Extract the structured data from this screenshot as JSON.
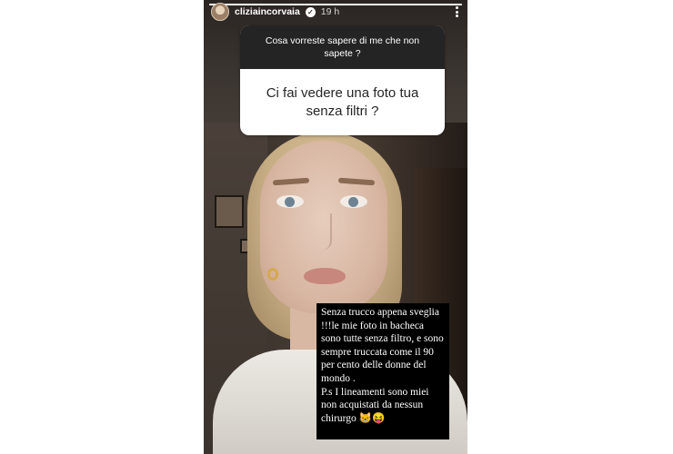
{
  "header": {
    "username": "cliziaincorvaia",
    "verified_icon": "verified-badge-icon",
    "time": "19 h",
    "more_icon": "more-vertical-icon",
    "progress": 1.0
  },
  "question_box": {
    "question": "Cosa vorreste sapere di me che non sapete ?",
    "answer": "Ci fai vedere una foto tua senza filtri ?"
  },
  "caption": {
    "text": "Senza trucco appena sveglia !!!le mie foto in bacheca sono tutte senza filtro, e sono sempre truccata come il 90 per cento delle donne del mondo .",
    "ps": "P.s I lineamenti sono miei non acquistati da nessun chirurgo 😸😝"
  },
  "colors": {
    "question_header_bg": "#242424",
    "question_body_bg": "#ffffff",
    "caption_bg": "#000000"
  }
}
